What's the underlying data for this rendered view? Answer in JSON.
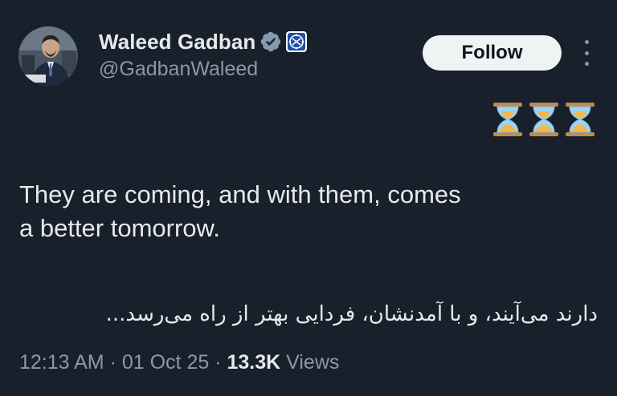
{
  "author": {
    "display_name": "Waleed Gadban",
    "handle": "@GadbanWaleed",
    "avatar": "avatar-photo",
    "verified_badge": "verified-badge-icon",
    "affiliation_badge": "affiliation-badge-icon"
  },
  "actions": {
    "follow_label": "Follow",
    "more": "more-options-icon"
  },
  "tweet": {
    "emoji": [
      "hourglass-icon",
      "hourglass-icon",
      "hourglass-icon"
    ],
    "text_en_line1": "They are coming, and with them, comes",
    "text_en_line2": "a better tomorrow.",
    "text_fa": "دارند می‌آیند، و با آمدنشان، فردایی بهتر از راه می‌رسد..."
  },
  "meta": {
    "time": "12:13 AM",
    "sep1": " · ",
    "date": "01 Oct 25",
    "sep2": " · ",
    "views_count": "13.3K",
    "views_label": " Views"
  },
  "colors": {
    "background": "#17202b",
    "text_primary": "#e7e9ea",
    "text_secondary": "#8b98a5",
    "verified": "#829aab",
    "follow_bg": "#eff3f4"
  }
}
